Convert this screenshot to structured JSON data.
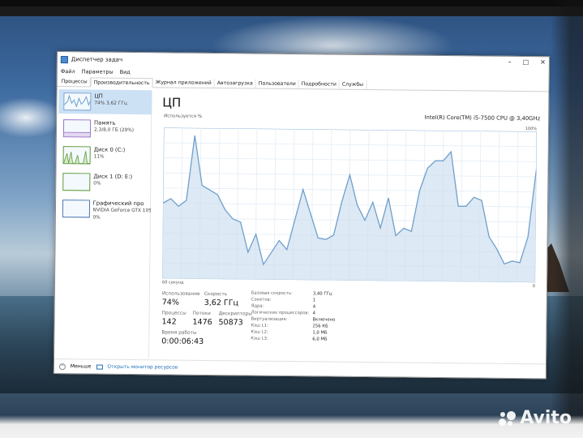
{
  "window": {
    "title": "Диспетчер задач",
    "controls": [
      "–",
      "□",
      "✕"
    ]
  },
  "menu": [
    "Файл",
    "Параметры",
    "Вид"
  ],
  "tabs": [
    "Процессы",
    "Производительность",
    "Журнал приложений",
    "Автозагрузка",
    "Пользователи",
    "Подробности",
    "Службы"
  ],
  "sidebar": {
    "items": [
      {
        "name": "ЦП",
        "sub": "74% 3,62 ГГц"
      },
      {
        "name": "Память",
        "sub": "2,3/8,0 ГБ (29%)"
      },
      {
        "name": "Диск 0 (C:)",
        "sub": "11%"
      },
      {
        "name": "Диск 1 (D: E:)",
        "sub": "0%"
      },
      {
        "name": "Графический про",
        "sub": "NVIDIA GeForce GTX 105",
        "sub2": "0%"
      }
    ]
  },
  "main": {
    "title": "ЦП",
    "model": "Intel(R) Core(TM) i5-7500 CPU @ 3,40GHz",
    "util_label": "Используется %",
    "max_label": "100%",
    "time_label": "60 секунд",
    "zero_label": "0",
    "stats": {
      "usage_label": "Использование",
      "usage": "74%",
      "speed_label": "Скорость",
      "speed": "3,62 ГГц",
      "procs_label": "Процессы",
      "procs": "142",
      "threads_label": "Потоки",
      "threads": "1476",
      "handles_label": "Дескрипторы",
      "handles": "50873",
      "uptime_label": "Время работы",
      "uptime": "0:00:06:43"
    },
    "specs": [
      {
        "label": "Базовая скорость:",
        "value": "3,40 ГГц"
      },
      {
        "label": "Сокетов:",
        "value": "1"
      },
      {
        "label": "Ядра:",
        "value": "4"
      },
      {
        "label": "Логических процессоров:",
        "value": "4"
      },
      {
        "label": "Виртуализация:",
        "value": "Включено"
      },
      {
        "label": "Кэш L1:",
        "value": "256 КБ"
      },
      {
        "label": "Кэш L2:",
        "value": "1,0 МБ"
      },
      {
        "label": "Кэш L3:",
        "value": "6,0 МБ"
      }
    ]
  },
  "cpu_history": [
    50,
    53,
    48,
    52,
    95,
    62,
    59,
    56,
    46,
    40,
    38,
    18,
    30,
    10,
    18,
    26,
    20,
    40,
    60,
    44,
    28,
    27,
    30,
    52,
    70,
    50,
    40,
    52,
    35,
    55,
    30,
    35,
    33,
    60,
    75,
    80,
    80,
    86,
    50,
    50,
    56,
    54,
    30,
    22,
    12,
    14,
    13,
    30,
    75
  ],
  "footer": {
    "less": "Меньше",
    "monitor": "Открыть монитор ресурсов"
  },
  "colors": {
    "graph_line": "#6f9fcc",
    "graph_fill": "#cfe0f0",
    "accent": "#1f6fb8",
    "selected": "#cde1f5"
  },
  "watermark": "Avito"
}
